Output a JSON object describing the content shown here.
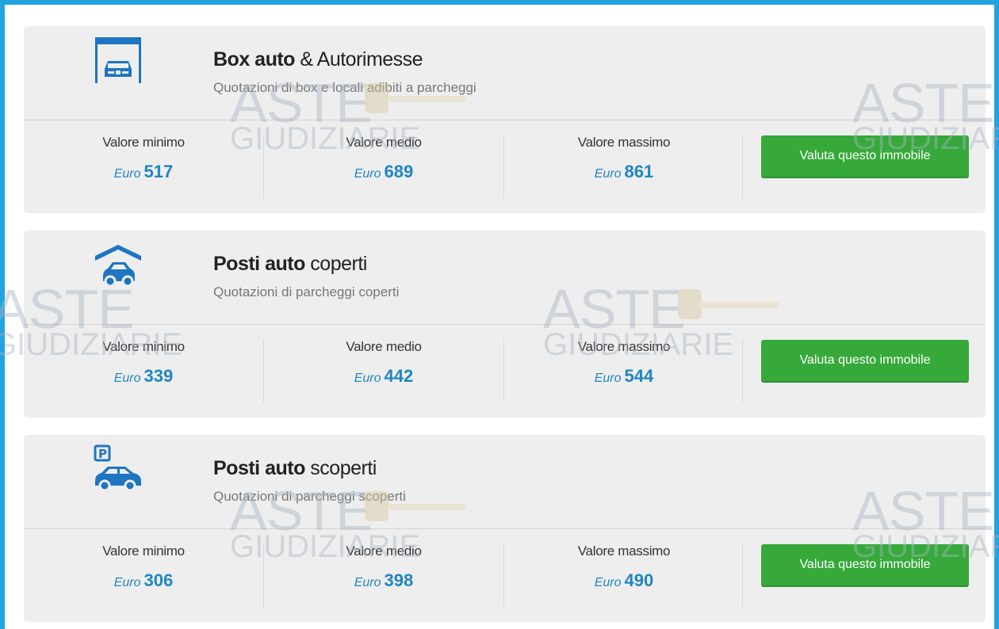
{
  "colors": {
    "frame": "#21a3df",
    "card_bg": "#eeeeee",
    "value_blue": "#1f86c1",
    "button_green": "#36a93a",
    "icon_blue": "#1e75c2"
  },
  "watermark": {
    "line1": "ASTE",
    "line2": "GIUDIZIARIE"
  },
  "cards": [
    {
      "icon": "garage-icon",
      "title_bold": "Box auto",
      "title_rest": " & Autorimesse",
      "subtitle": "Quotazioni di box e locali adibiti a parcheggi",
      "min": {
        "label": "Valore minimo",
        "currency": "Euro",
        "amount": "517"
      },
      "avg": {
        "label": "Valore medio",
        "currency": "Euro",
        "amount": "689"
      },
      "max": {
        "label": "Valore massimo",
        "currency": "Euro",
        "amount": "861"
      },
      "button": "Valuta questo immobile"
    },
    {
      "icon": "covered-parking-icon",
      "title_bold": "Posti auto",
      "title_rest": " coperti",
      "subtitle": "Quotazioni di parcheggi coperti",
      "min": {
        "label": "Valore minimo",
        "currency": "Euro",
        "amount": "339"
      },
      "avg": {
        "label": "Valore medio",
        "currency": "Euro",
        "amount": "442"
      },
      "max": {
        "label": "Valore massimo",
        "currency": "Euro",
        "amount": "544"
      },
      "button": "Valuta questo immobile"
    },
    {
      "icon": "open-parking-icon",
      "title_bold": "Posti auto",
      "title_rest": " scoperti",
      "subtitle": "Quotazioni di parcheggi scoperti",
      "min": {
        "label": "Valore minimo",
        "currency": "Euro",
        "amount": "306"
      },
      "avg": {
        "label": "Valore medio",
        "currency": "Euro",
        "amount": "398"
      },
      "max": {
        "label": "Valore massimo",
        "currency": "Euro",
        "amount": "490"
      },
      "button": "Valuta questo immobile"
    }
  ]
}
